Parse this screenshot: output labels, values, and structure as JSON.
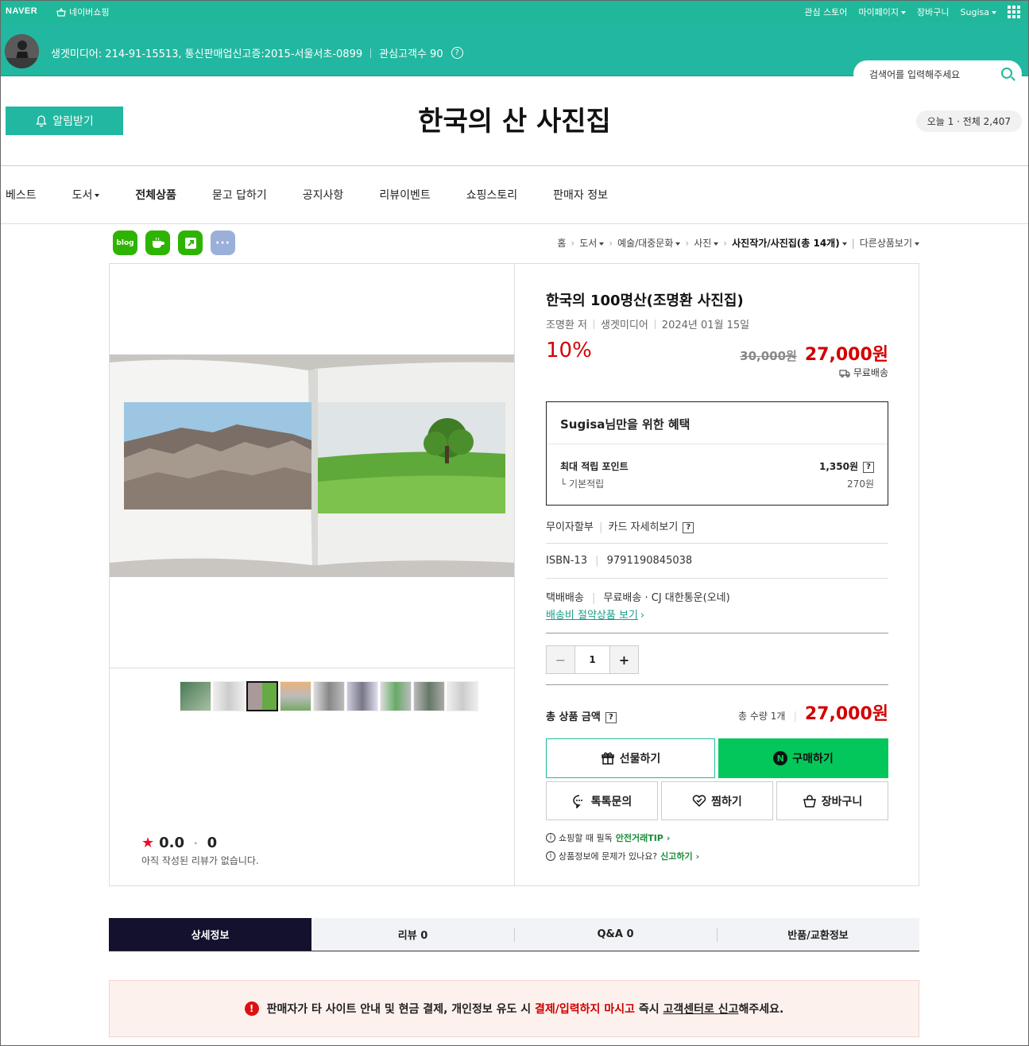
{
  "topbar": {
    "logo": "NAVER",
    "shop_label": "네이버쇼핑",
    "links": [
      "관심 스토어",
      "마이페이지",
      "장바구니",
      "Sugisa"
    ]
  },
  "seller": {
    "info": "생겟미디어: 214-91-15513, 통신판매업신고증:2015-서울서초-0899",
    "interest": "관심고객수 90",
    "search_placeholder": "검색어를 입력해주세요"
  },
  "header": {
    "alarm_label": "알림받기",
    "store_title": "한국의 산 사진집",
    "visit_count": "오늘 1 · 전체 2,407"
  },
  "nav": [
    "베스트",
    "도서",
    "전체상품",
    "묻고 답하기",
    "공지사항",
    "리뷰이벤트",
    "쇼핑스토리",
    "판매자 정보"
  ],
  "share": {
    "blog": "blog",
    "more": "···"
  },
  "breadcrumb": [
    "홈",
    "도서",
    "예술/대중문화",
    "사진",
    "사진작가/사진집(총 14개)",
    "다른상품보기"
  ],
  "product": {
    "title": "한국의 100명산(조명환 사진집)",
    "author": "조명환 저",
    "publisher": "생겟미디어",
    "date": "2024년 01월 15일",
    "discount": "10%",
    "original_price": "30,000원",
    "sale_price": "27,000원",
    "shipping_badge": "무료배송",
    "benefit_user": "Sugisa",
    "benefit_title": "님만을 위한 혜택",
    "max_point_label": "최대 적립 포인트",
    "max_point": "1,350원",
    "base_point_label": "기본적립",
    "base_point": "270원",
    "installment": "무이자할부",
    "card_detail": "카드 자세히보기",
    "isbn_label": "ISBN-13",
    "isbn": "9791190845038",
    "delivery_label": "택배배송",
    "delivery_info": "무료배송 · CJ 대한통운(오네)",
    "ship_link": "배송비 절약상품 보기",
    "quantity": "1",
    "total_label": "총 상품 금액",
    "total_qty": "총 수량 1개",
    "total_price": "27,000원",
    "btn_gift": "선물하기",
    "btn_buy": "구매하기",
    "btn_talk": "톡톡문의",
    "btn_wish": "찜하기",
    "btn_cart": "장바구니",
    "tip1_text": "쇼핑할 때 필독",
    "tip1_link": "안전거래TIP",
    "tip2_text": "상품정보에 문제가 있나요?",
    "tip2_link": "신고하기"
  },
  "review": {
    "score": "0.0",
    "count": "0",
    "empty_text": "아직 작성된 리뷰가 없습니다."
  },
  "tabs": [
    "상세정보",
    "리뷰 0",
    "Q&A 0",
    "반품/교환정보"
  ],
  "warning": {
    "part1": "판매자가 타 사이트 안내 및 현금 결제, 개인정보 유도 시",
    "part2": "결제/입력하지 마시고",
    "part3": "즉시",
    "part4": "고객센터로 신고",
    "part5": "해주세요."
  }
}
